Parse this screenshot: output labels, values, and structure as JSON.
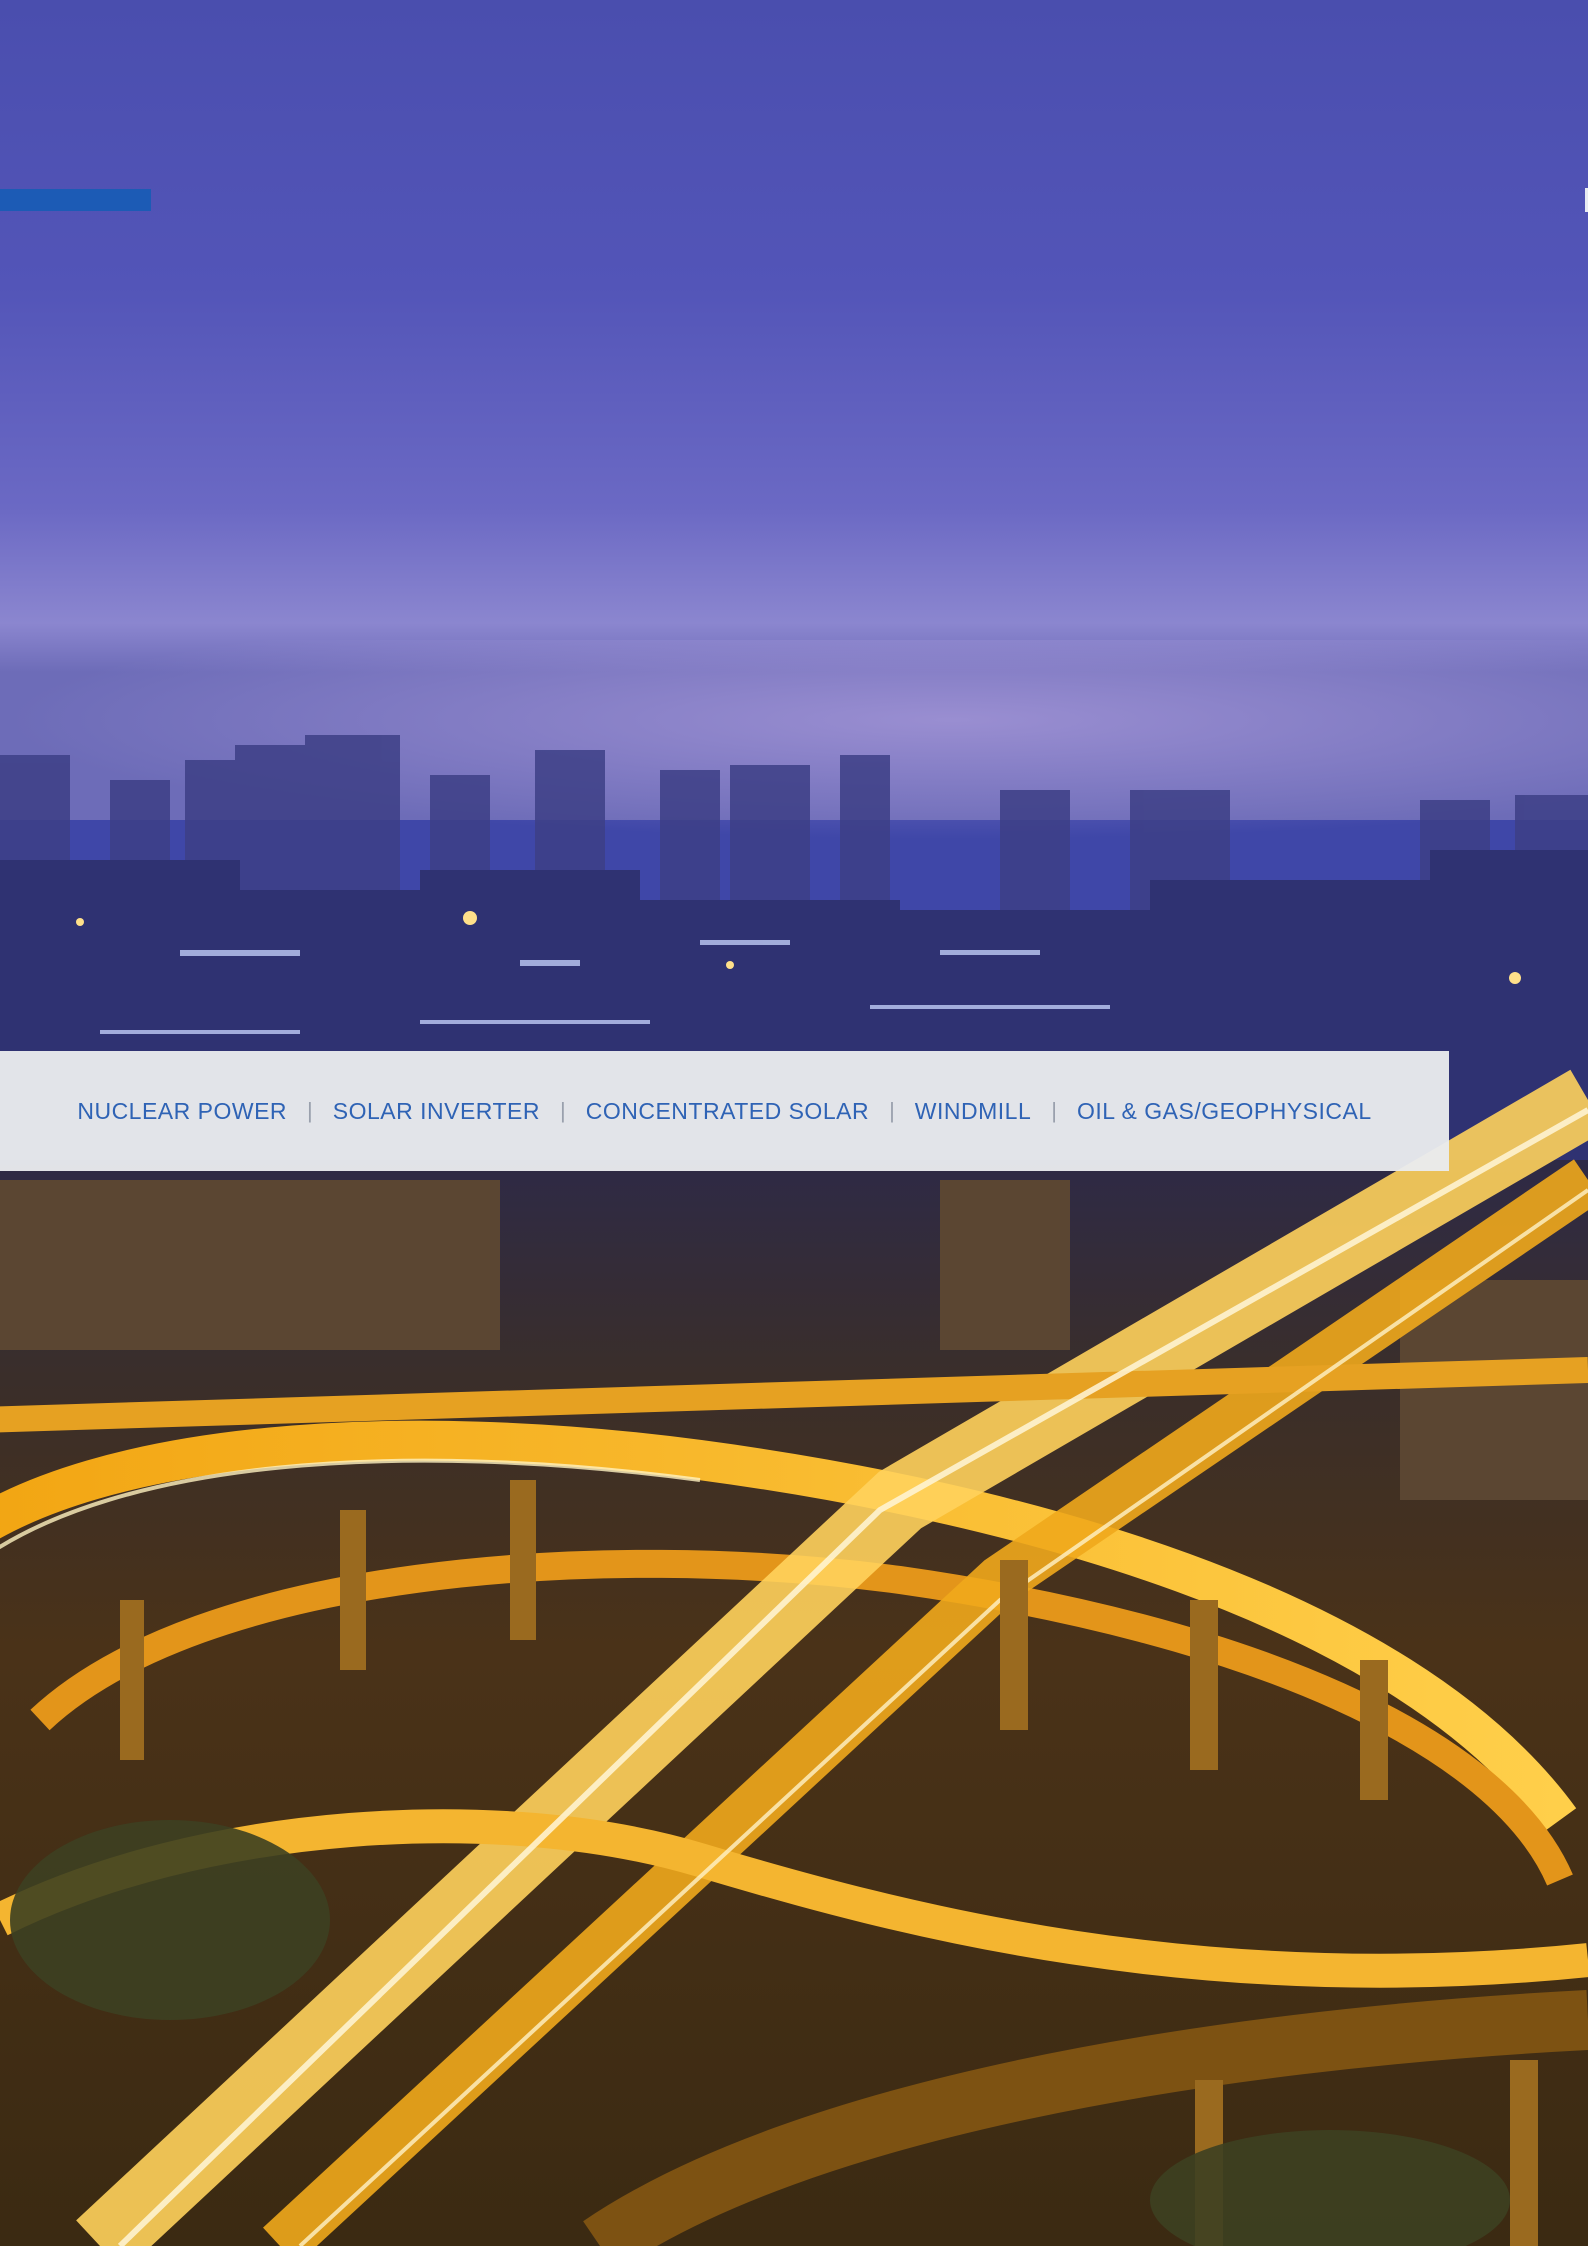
{
  "categories": [
    "NUCLEAR POWER",
    "SOLAR INVERTER",
    "CONCENTRATED SOLAR",
    "WINDMILL",
    "OIL & GAS/GEOPHYSICAL"
  ],
  "separator": "|",
  "colors": {
    "accent": "#1c5bb5",
    "category_text": "#2f63b5",
    "band": "#e9ebee",
    "sky_top": "#4a4eae",
    "road_light": "#f5b71c"
  },
  "background_image": "night-city-highway-interchange-photo"
}
